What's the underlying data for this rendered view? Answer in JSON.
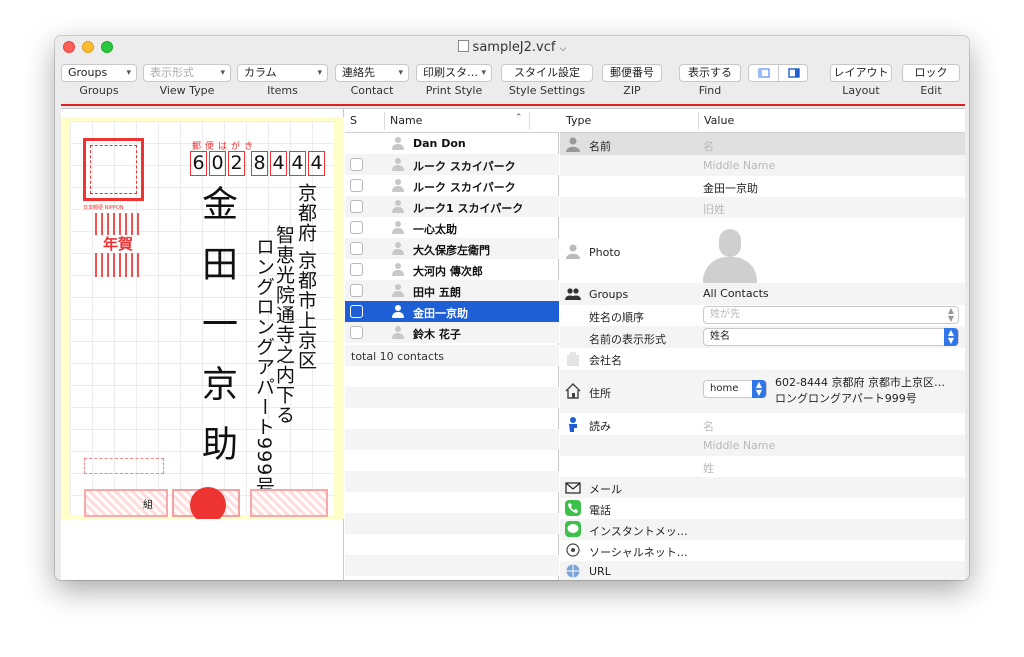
{
  "window": {
    "title": "sampleJ2.vcf"
  },
  "toolbar": {
    "groups_value": "Groups",
    "viewtype_value": "表示形式",
    "items_value": "カラム",
    "contact_value": "連絡先",
    "printstyle_value": "印刷スタ…",
    "stylesettings_btn": "スタイル設定",
    "zip_btn": "郵便番号",
    "find_btn": "表示する",
    "layout_btn": "レイアウト",
    "edit_btn": "ロック",
    "labels": {
      "groups": "Groups",
      "viewtype": "View Type",
      "items": "Items",
      "contact": "Contact",
      "printstyle": "Print Style",
      "stylesettings": "Style Settings",
      "zip": "ZIP",
      "find": "Find",
      "layout": "Layout",
      "edit": "Edit"
    }
  },
  "postcard": {
    "yubin_hagaki": "郵便はがき",
    "zip_digits": [
      "6",
      "0",
      "2",
      "8",
      "4",
      "4",
      "4"
    ],
    "name_vertical": "金田一京助",
    "address_line1": "京都府 京都市上京区",
    "address_line2": "智恵光院通寺之内下る",
    "address_line3": "ロングロングアパート999号",
    "nenga": "年賀",
    "stamp_caption": "日本郵便 NIPPON",
    "kumi": "組"
  },
  "list": {
    "col_s": "S",
    "col_name": "Name",
    "rows": [
      {
        "name": "Dan Don",
        "bold": true,
        "checkbox": false
      },
      {
        "name": "ルーク スカイパーク",
        "bold": true,
        "checkbox": true
      },
      {
        "name": "ルーク スカイパーク",
        "bold": true,
        "checkbox": true
      },
      {
        "name": "ルーク1 スカイパーク",
        "bold": true,
        "checkbox": true
      },
      {
        "name": "一心太助",
        "bold": true,
        "checkbox": true
      },
      {
        "name": "大久保彦左衛門",
        "bold": true,
        "checkbox": true
      },
      {
        "name": "大河内 傳次郎",
        "bold": true,
        "checkbox": true
      },
      {
        "name": "田中 五朗",
        "bold": true,
        "checkbox": true
      },
      {
        "name": "金田一京助",
        "bold": true,
        "checkbox": true,
        "selected": true
      },
      {
        "name": "鈴木 花子",
        "bold": true,
        "checkbox": true
      }
    ],
    "total": "total 10 contacts"
  },
  "detail": {
    "col_type": "Type",
    "col_value": "Value",
    "name_label": "名前",
    "name_ph": "名",
    "middle_ph": "Middle Name",
    "name_value": "金田一京助",
    "maiden_ph": "旧姓",
    "photo_label": "Photo",
    "groups_label": "Groups",
    "groups_value": "All Contacts",
    "order_label": "姓名の順序",
    "order_value": "姓が先",
    "display_label": "名前の表示形式",
    "display_value": "姓名",
    "company_label": "会社名",
    "address_label": "住所",
    "address_type": "home",
    "address_line1": "602-8444 京都府 京都市上京区…",
    "address_line2": "ロングロングアパート999号",
    "reading_label": "読み",
    "reading_first_ph": "名",
    "reading_middle_ph": "Middle Name",
    "reading_last_ph": "姓",
    "mail_label": "メール",
    "phone_label": "電話",
    "im_label": "インスタントメッ…",
    "social_label": "ソーシャルネット…",
    "url_label": "URL"
  },
  "colors": {
    "accent": "#1f5fd6",
    "red": "#e21d1d",
    "card_bg": "#ffffc8"
  }
}
